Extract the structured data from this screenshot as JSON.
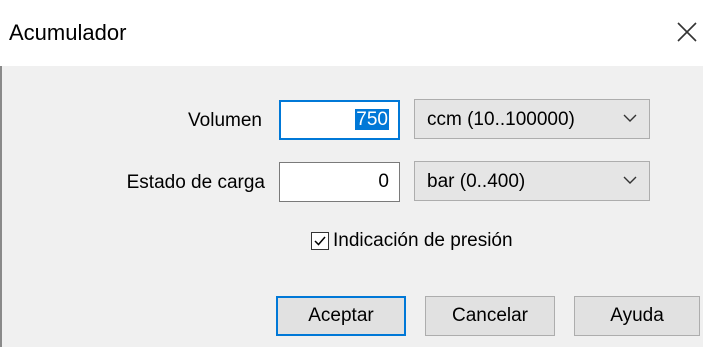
{
  "window": {
    "title": "Acumulador"
  },
  "form": {
    "volumen": {
      "label": "Volumen",
      "value": "750",
      "unit": "ccm  (10..100000)"
    },
    "estado": {
      "label": "Estado de carga",
      "value": "0",
      "unit": "bar  (0..400)"
    },
    "indicacion": {
      "label": "Indicación de presión",
      "checked": true
    }
  },
  "buttons": {
    "ok": "Aceptar",
    "cancel": "Cancelar",
    "help": "Ayuda"
  },
  "icons": {
    "close": "close-icon",
    "dropdown": "chevron-down-icon",
    "check": "checkmark-icon"
  },
  "colors": {
    "accent": "#0078d7",
    "dialog_bg": "#f0f0f0"
  }
}
